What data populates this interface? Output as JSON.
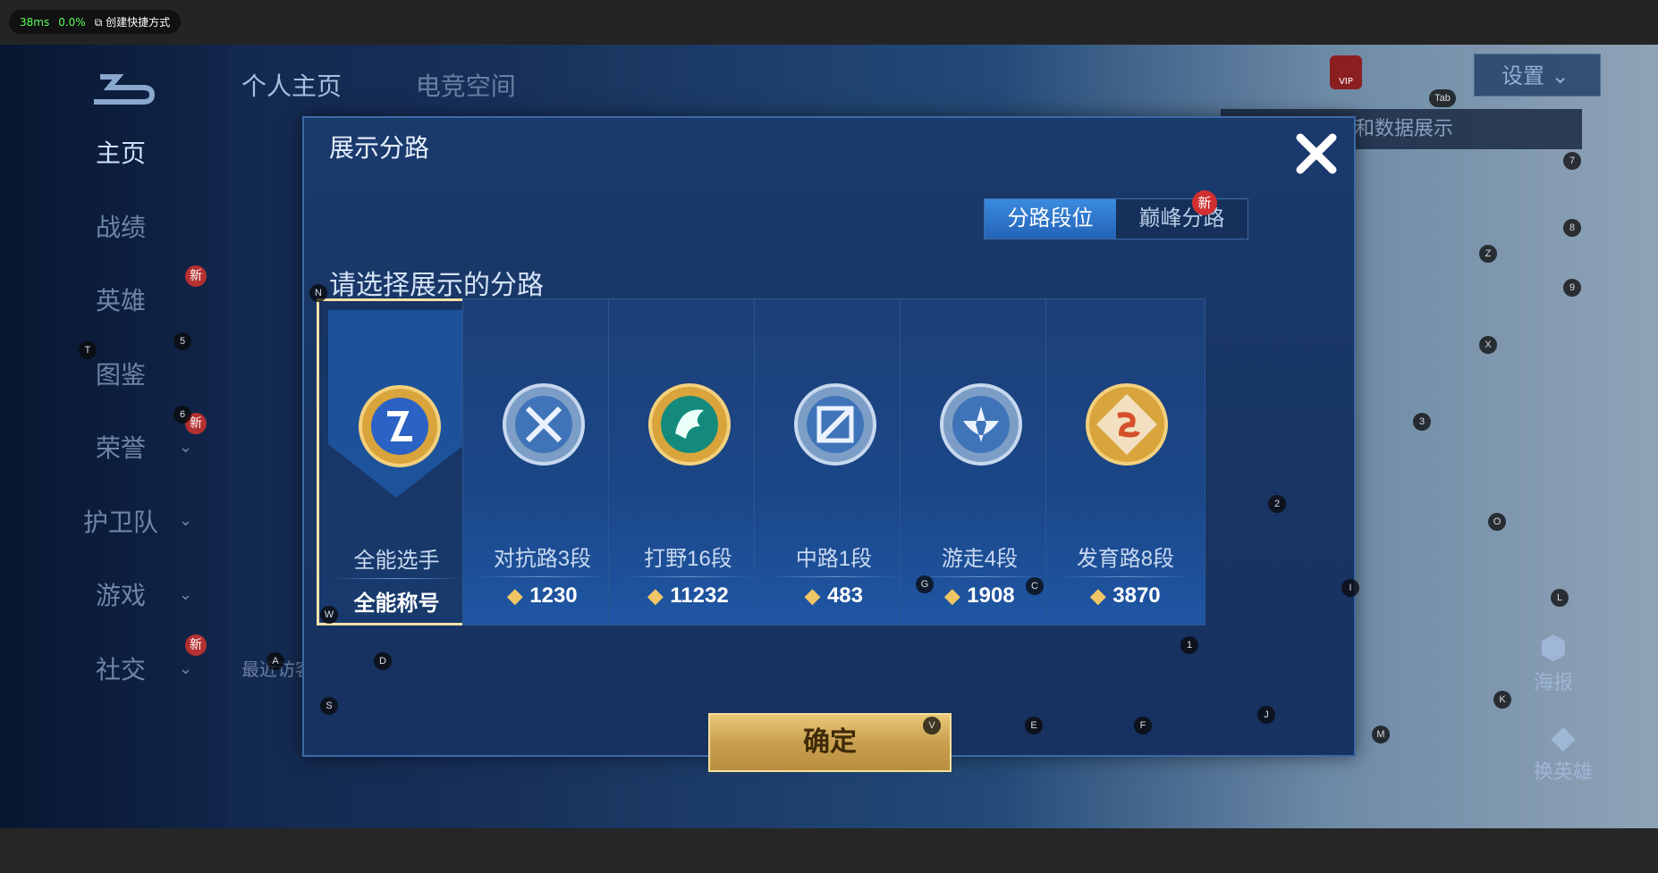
{
  "overlay": {
    "latency": "38ms",
    "usage": "0.0%",
    "shortcut_label": "创建快捷方式"
  },
  "nav": {
    "items": [
      {
        "label": "主页"
      },
      {
        "label": "战绩"
      },
      {
        "label": "英雄",
        "badge": "新",
        "hint": "5"
      },
      {
        "label": "图鉴",
        "hint": "6"
      },
      {
        "label": "荣誉",
        "badge": "新"
      },
      {
        "label": "护卫队"
      },
      {
        "label": "游戏"
      },
      {
        "label": "社交",
        "badge": "新"
      }
    ],
    "tabs": [
      "个人主页",
      "电竞空间"
    ],
    "visitors_label": "最近访客>"
  },
  "topright": {
    "settings_label": "设置",
    "tip": "以切换灵宝和数据展示",
    "vip": "VIP",
    "tab_hint": "Tab"
  },
  "side_buttons": {
    "poster": "海报",
    "hero": "换英雄"
  },
  "modal": {
    "title": "展示分路",
    "segments": [
      "分路段位",
      "巅峰分路"
    ],
    "segment_badge": "新",
    "prompt": "请选择展示的分路",
    "cards": [
      {
        "name": "全能选手",
        "score": "全能称号",
        "icon": "allround-icon",
        "selected": true
      },
      {
        "name": "对抗路3段",
        "score": "1230",
        "icon": "clash-lane-icon"
      },
      {
        "name": "打野16段",
        "score": "11232",
        "icon": "jungle-icon"
      },
      {
        "name": "中路1段",
        "score": "483",
        "icon": "mid-lane-icon"
      },
      {
        "name": "游走4段",
        "score": "1908",
        "icon": "roam-icon"
      },
      {
        "name": "发育路8段",
        "score": "3870",
        "icon": "farm-lane-icon"
      }
    ],
    "confirm_label": "确定"
  },
  "key_hints": [
    "N",
    "W",
    "A",
    "D",
    "S",
    "V",
    "E",
    "F",
    "J",
    "M",
    "K",
    "L",
    "O",
    "3",
    "X",
    "9",
    "8",
    "Z",
    "7",
    "G",
    "C",
    "I",
    "1",
    "2",
    "T"
  ],
  "colors": {
    "accent": "#2363b6",
    "gold": "#c9a04f",
    "selected_border": "#f4e2a8"
  }
}
